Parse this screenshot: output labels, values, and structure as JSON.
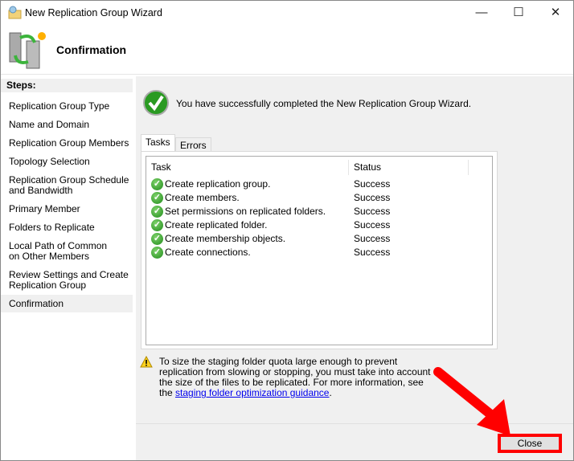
{
  "window": {
    "title": "New Replication Group Wizard",
    "minimize": "—",
    "maximize": "☐",
    "close": "✕"
  },
  "header": {
    "title": "Confirmation"
  },
  "sidebar": {
    "heading": "Steps:",
    "items": [
      {
        "label": "Replication Group Type"
      },
      {
        "label": "Name and Domain"
      },
      {
        "label": "Replication Group Members"
      },
      {
        "label": "Topology Selection"
      },
      {
        "label": "Replication Group Schedule and Bandwidth"
      },
      {
        "label": "Primary Member"
      },
      {
        "label": "Folders to Replicate"
      },
      {
        "label": "Local Path of Common on Other Members"
      },
      {
        "label": "Review Settings and Create Replication Group"
      },
      {
        "label": "Confirmation",
        "selected": true
      }
    ]
  },
  "main": {
    "success_message": "You have successfully completed the New Replication Group Wizard.",
    "tabs": [
      {
        "label": "Tasks",
        "active": true
      },
      {
        "label": "Errors"
      }
    ],
    "columns": [
      "Task",
      "Status"
    ],
    "rows": [
      {
        "task": "Create replication group.",
        "status": "Success"
      },
      {
        "task": "Create members.",
        "status": "Success"
      },
      {
        "task": "Set permissions on replicated folders.",
        "status": "Success"
      },
      {
        "task": "Create replicated folder.",
        "status": "Success"
      },
      {
        "task": "Create membership objects.",
        "status": "Success"
      },
      {
        "task": "Create connections.",
        "status": "Success"
      }
    ],
    "warning_text": "To size the staging folder quota large enough to prevent replication from slowing or stopping, you must take into account the size of the files to be replicated. For more information, see the ",
    "warning_link": "staging folder optimization guidance",
    "warning_end": "."
  },
  "footer": {
    "close_label": "Close"
  },
  "colors": {
    "annotation": "#ff0000",
    "success_green": "#1f8a1a"
  }
}
